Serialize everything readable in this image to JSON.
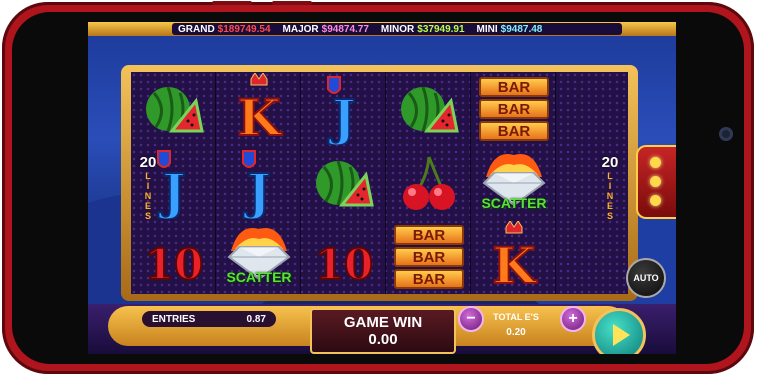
{
  "jackpots": [
    {
      "label": "GRAND",
      "value": "$189749.54",
      "color": "#ff4a4a"
    },
    {
      "label": "MAJOR",
      "value": "$94874.77",
      "color": "#ff8adf"
    },
    {
      "label": "MINOR",
      "value": "$37949.91",
      "color": "#b7ff4a"
    },
    {
      "label": "MINI",
      "value": "$9487.48",
      "color": "#7ff0ff"
    }
  ],
  "lines": {
    "count": "20",
    "word": "LINES"
  },
  "reels": {
    "symbols": [
      [
        "watermelon",
        "K",
        "J",
        "watermelon",
        "bar"
      ],
      [
        "J",
        "J",
        "watermelon",
        "cherry",
        "scatter"
      ],
      [
        "10",
        "scatter",
        "10",
        "bar",
        "K"
      ]
    ],
    "bar_text": "BAR",
    "scatter_text": "SCATTER"
  },
  "controls": {
    "entries_label": "ENTRIES",
    "entries_value": "0.87",
    "game_win_label": "GAME WIN",
    "game_win_value": "0.00",
    "total_bet_label": "TOTAL E'S",
    "total_bet_value": "0.20",
    "minus_label": "−",
    "plus_label": "+",
    "auto_label": "AUTO"
  }
}
